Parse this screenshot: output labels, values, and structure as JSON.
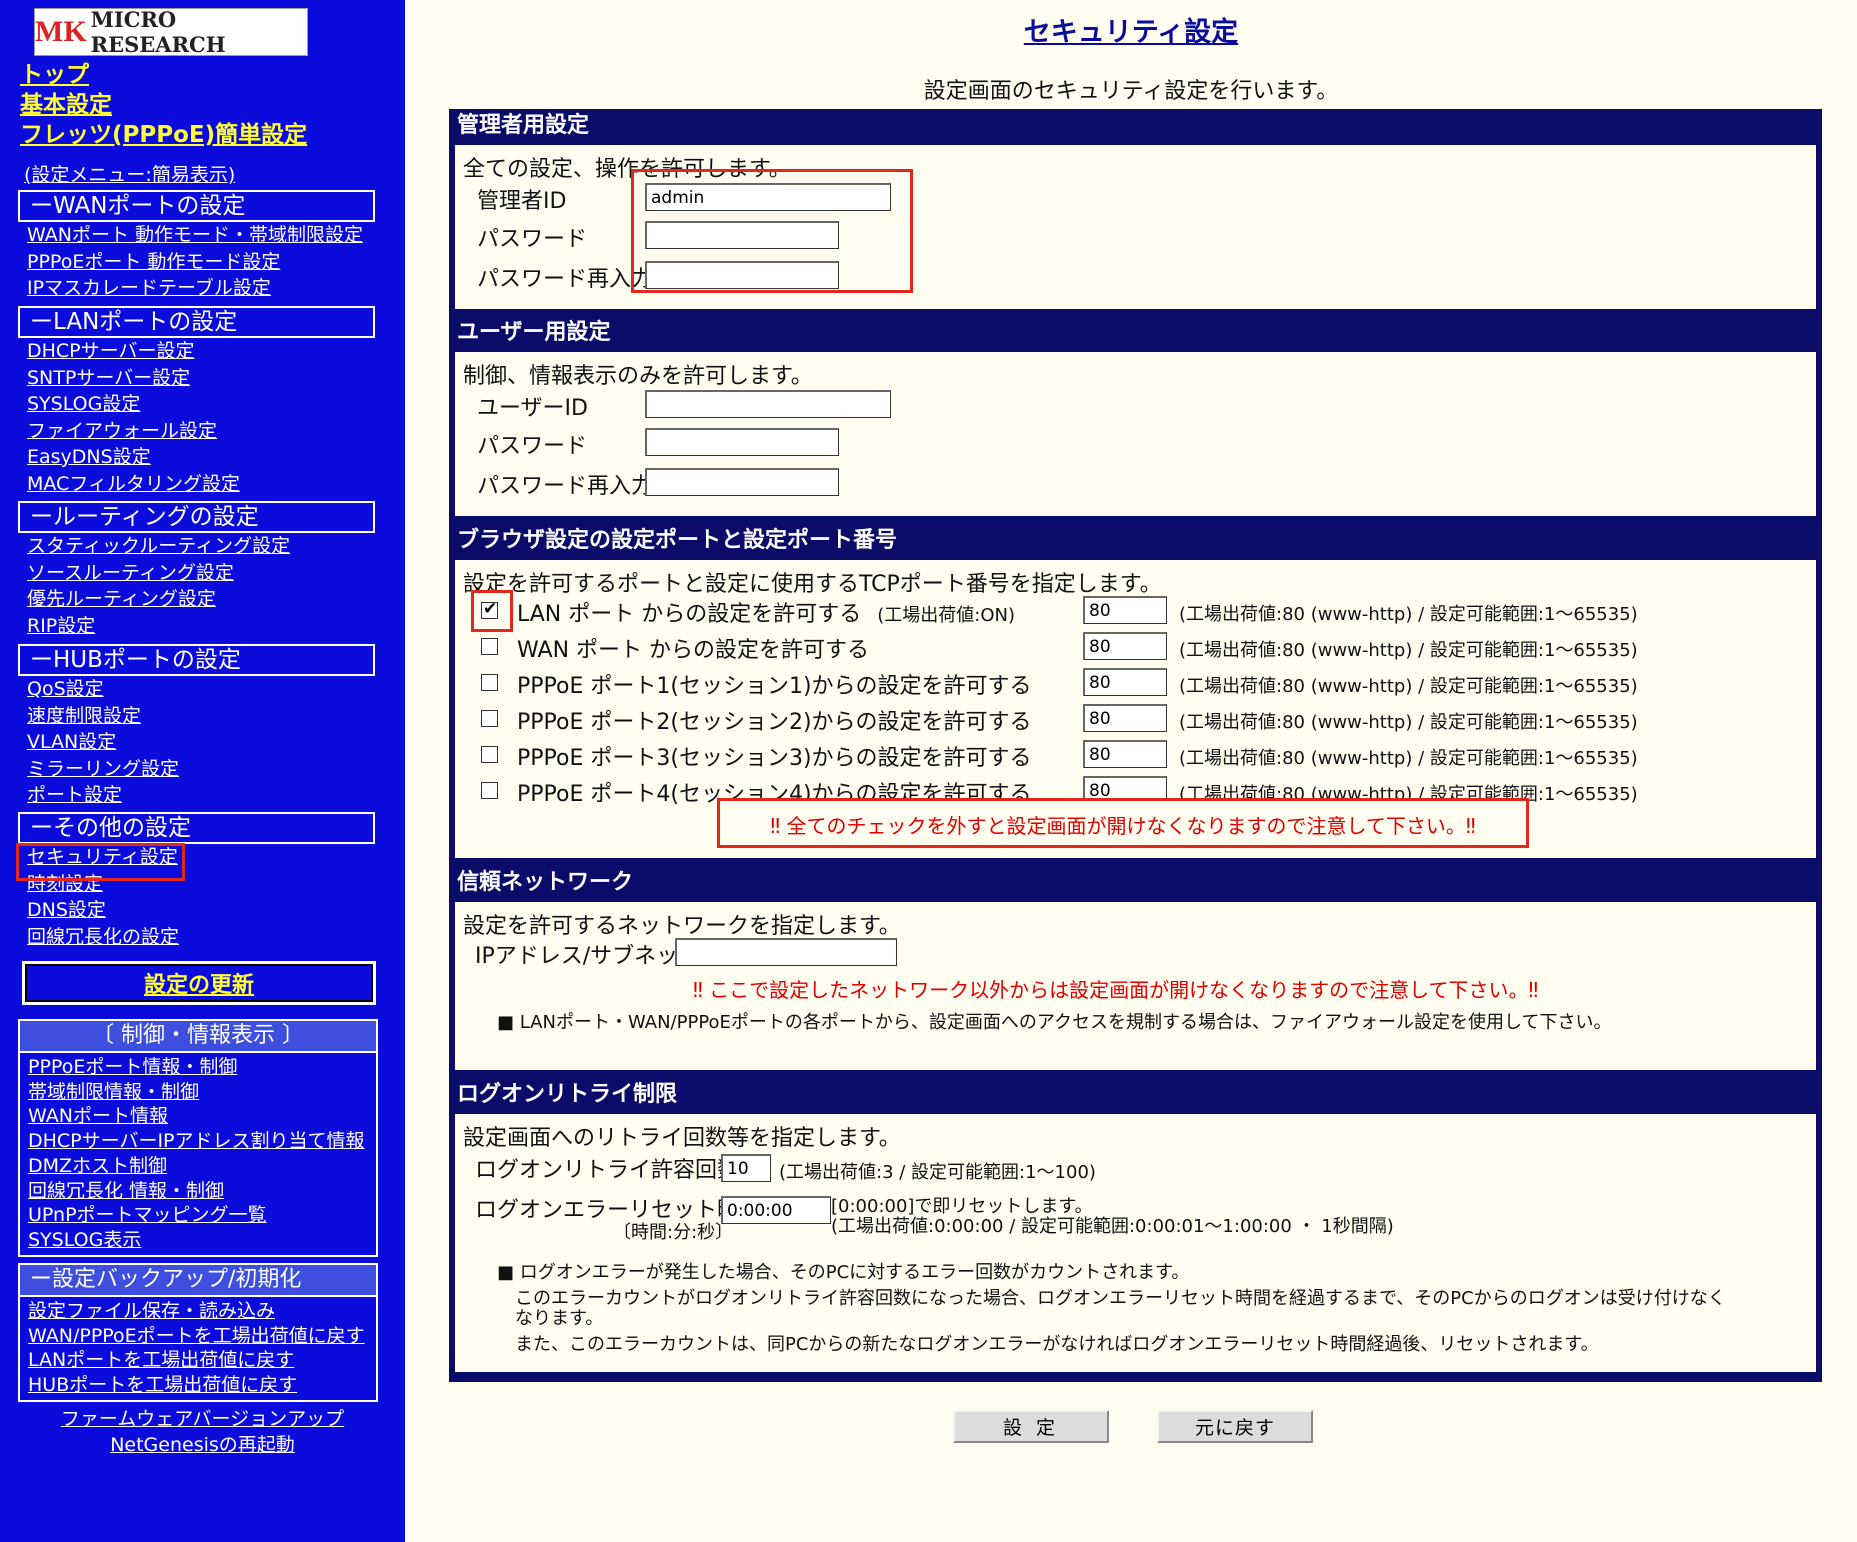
{
  "logo": {
    "mark": "MK",
    "text": "MICRO RESEARCH"
  },
  "sidebar": {
    "top_links": [
      "トップ",
      "基本設定",
      "フレッツ(PPPoE)簡単設定"
    ],
    "menu_mode": "(設定メニュー:簡易表示)",
    "sections": [
      {
        "title": "ーWANポートの設定",
        "items": [
          "WANポート 動作モード・帯域制限設定",
          "PPPoEポート 動作モード設定",
          "IPマスカレードテーブル設定"
        ]
      },
      {
        "title": "ーLANポートの設定",
        "items": [
          "DHCPサーバー設定",
          "SNTPサーバー設定",
          "SYSLOG設定",
          "ファイアウォール設定",
          "EasyDNS設定",
          "MACフィルタリング設定"
        ]
      },
      {
        "title": "ールーティングの設定",
        "items": [
          "スタティックルーティング設定",
          "ソースルーティング設定",
          "優先ルーティング設定",
          "RIP設定"
        ]
      },
      {
        "title": "ーHUBポートの設定",
        "items": [
          "QoS設定",
          "速度制限設定",
          "VLAN設定",
          "ミラーリング設定",
          "ポート設定"
        ]
      },
      {
        "title": "ーその他の設定",
        "items": [
          "セキュリティ設定",
          "時刻設定",
          "DNS設定",
          "回線冗長化の設定"
        ]
      }
    ],
    "update_button": "設定の更新",
    "control_box": {
      "title": "〔 制御・情報表示 〕",
      "items": [
        "PPPoEポート情報・制御",
        "帯域制限情報・制御",
        "WANポート情報",
        "DHCPサーバーIPアドレス割り当て情報",
        "DMZホスト制御",
        "回線冗長化 情報・制御",
        "UPnPポートマッピング一覧",
        "SYSLOG表示"
      ]
    },
    "backup_box": {
      "title": "ー設定バックアップ/初期化",
      "items": [
        "設定ファイル保存・読み込み",
        "WAN/PPPoEポートを工場出荷値に戻す",
        "LANポートを工場出荷値に戻す",
        "HUBポートを工場出荷値に戻す"
      ]
    },
    "firmware": "ファームウェアバージョンアップ",
    "reboot": "NetGenesisの再起動"
  },
  "main": {
    "title": "セキュリティ設定",
    "description": "設定画面のセキュリティ設定を行います。",
    "admin": {
      "header": "管理者用設定",
      "desc": "全ての設定、操作を許可します。",
      "id_label": "管理者ID",
      "id_value": "admin",
      "pw_label": "パスワード",
      "pw2_label": "パスワード再入力"
    },
    "user": {
      "header": "ユーザー用設定",
      "desc": "制御、情報表示のみを許可します。",
      "id_label": "ユーザーID",
      "pw_label": "パスワード",
      "pw2_label": "パスワード再入力"
    },
    "browser": {
      "header": "ブラウザ設定の設定ポートと設定ポート番号",
      "desc": "設定を許可するポートと設定に使用するTCPポート番号を指定します。",
      "ports": [
        {
          "label": "LAN ポート からの設定を許可する",
          "note": "(工場出荷値:ON)",
          "checked": true,
          "value": "80",
          "range": "(工場出荷値:80 (www-http) / 設定可能範囲:1〜65535)"
        },
        {
          "label": "WAN ポート からの設定を許可する",
          "note": "",
          "checked": false,
          "value": "80",
          "range": "(工場出荷値:80 (www-http) / 設定可能範囲:1〜65535)"
        },
        {
          "label": "PPPoE ポート1(セッション1)からの設定を許可する",
          "note": "",
          "checked": false,
          "value": "80",
          "range": "(工場出荷値:80 (www-http) / 設定可能範囲:1〜65535)"
        },
        {
          "label": "PPPoE ポート2(セッション2)からの設定を許可する",
          "note": "",
          "checked": false,
          "value": "80",
          "range": "(工場出荷値:80 (www-http) / 設定可能範囲:1〜65535)"
        },
        {
          "label": "PPPoE ポート3(セッション3)からの設定を許可する",
          "note": "",
          "checked": false,
          "value": "80",
          "range": "(工場出荷値:80 (www-http) / 設定可能範囲:1〜65535)"
        },
        {
          "label": "PPPoE ポート4(セッション4)からの設定を許可する",
          "note": "",
          "checked": false,
          "value": "80",
          "range": "(工場出荷値:80 (www-http) / 設定可能範囲:1〜65535)"
        }
      ],
      "warning": "‼ 全てのチェックを外すと設定画面が開けなくなりますので注意して下さい。‼"
    },
    "trusted": {
      "header": "信頼ネットワーク",
      "desc": "設定を許可するネットワークを指定します。",
      "ip_label": "IPアドレス/サブネット",
      "warning": "‼ ここで設定したネットワーク以外からは設定画面が開けなくなりますので注意して下さい。‼",
      "note": "■ LANポート・WAN/PPPoEポートの各ポートから、設定画面へのアクセスを規制する場合は、ファイアウォール設定を使用して下さい。"
    },
    "logon": {
      "header": "ログオンリトライ制限",
      "desc": "設定画面へのリトライ回数等を指定します。",
      "retry_label": "ログオンリトライ許容回数",
      "retry_value": "10",
      "retry_note": "(工場出荷値:3 / 設定可能範囲:1〜100)",
      "reset_label": "ログオンエラーリセット時間",
      "reset_sublabel": "〔時間:分:秒〕",
      "reset_value": "0:00:00",
      "reset_note1": "[0:00:00]で即リセットします。",
      "reset_note2": "(工場出荷値:0:00:00 / 設定可能範囲:0:00:01〜1:00:00 ・ 1秒間隔)",
      "notes": [
        "■ ログオンエラーが発生した場合、そのPCに対するエラー回数がカウントされます。",
        "このエラーカウントがログオンリトライ許容回数になった場合、ログオンエラーリセット時間を経過するまで、そのPCからのログオンは受け付けなく",
        "なります。",
        "また、このエラーカウントは、同PCからの新たなログオンエラーがなければログオンエラーリセット時間経過後、リセットされます。"
      ]
    },
    "buttons": {
      "submit": "設 定",
      "reset": "元に戻す"
    }
  },
  "colors": {
    "sidebar_bg": "#0b0bdc",
    "panel_header": "#0b0b6a",
    "highlight": "#e0281f",
    "link_yellow": "#ffff33",
    "warning": "#e00000"
  }
}
